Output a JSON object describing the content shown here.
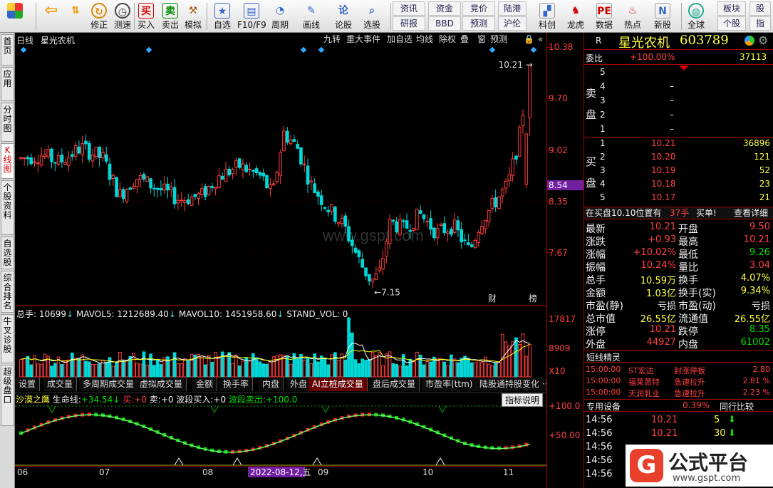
{
  "toolbar": {
    "buttons": [
      {
        "id": "home",
        "label": "",
        "icon": "grid-icon"
      },
      {
        "id": "back",
        "label": "",
        "icon": "back-arrow-icon"
      },
      {
        "id": "updown",
        "label": "",
        "icon": "up-down-icon"
      },
      {
        "id": "xiuzheng",
        "label": "修正",
        "icon": "repair-icon"
      },
      {
        "id": "cece",
        "label": "测速",
        "icon": "clock-icon"
      },
      {
        "id": "mairu",
        "label": "买入",
        "icon": "buy-icon"
      },
      {
        "id": "maichu",
        "label": "卖出",
        "icon": "sell-icon"
      },
      {
        "id": "moni",
        "label": "模拟",
        "icon": "hammer-icon"
      },
      {
        "id": "zixuan",
        "label": "自选",
        "icon": "star-icon"
      },
      {
        "id": "f10",
        "label": "F10/F9",
        "icon": "window-icon"
      },
      {
        "id": "zhouqi",
        "label": "周期",
        "icon": "period-icon"
      },
      {
        "id": "huaxian",
        "label": "画线",
        "icon": "pencil-icon"
      },
      {
        "id": "lungu",
        "label": "论股",
        "icon": "discuss-icon"
      },
      {
        "id": "xuangu",
        "label": "选股",
        "icon": "magnifier-icon"
      }
    ],
    "grid_buttons": [
      [
        "资讯",
        "资金",
        "竞价",
        "陆港"
      ],
      [
        "研报",
        "BBD",
        "预测",
        "沪伦"
      ]
    ],
    "right_buttons": [
      {
        "id": "kechuang",
        "label": "科创",
        "icon": "chart-icon"
      },
      {
        "id": "longhu",
        "label": "龙虎",
        "icon": "dragon-icon"
      },
      {
        "id": "shuju",
        "label": "数据",
        "icon": "pe-icon"
      },
      {
        "id": "redian",
        "label": "热点",
        "icon": "fire-icon"
      },
      {
        "id": "xingu",
        "label": "新股",
        "icon": "newstock-icon"
      },
      {
        "id": "quanqiu",
        "label": "全球",
        "icon": "globe-icon"
      },
      {
        "id": "bankuai",
        "label": "板块"
      },
      {
        "id": "gegu",
        "label": "个股"
      },
      {
        "id": "gu",
        "label": "股"
      },
      {
        "id": "zhi",
        "label": "指"
      }
    ]
  },
  "left_tabs": [
    "首页",
    "应用",
    "分时图",
    "K线图",
    "个股资料",
    "自选股",
    "综合排名",
    "牛叉诊股",
    "超级盘口"
  ],
  "chart": {
    "period": "日线",
    "name": "星光农机",
    "buttons": [
      "九转",
      "重大事件",
      "加自选",
      "均线",
      "除权",
      "叠",
      "窗",
      "预测",
      "🔒",
      "«"
    ],
    "high_label": "10.21",
    "low_label": "7.15",
    "price_marker": "8.54",
    "yticks": [
      "10.38",
      "9.70",
      "9.02",
      "8.35",
      "7.67"
    ],
    "tags": [
      "财",
      "榜"
    ],
    "watermark": "www.gspt.com"
  },
  "volume": {
    "header": {
      "label": "总手:",
      "value": "10699",
      "mavol5_label": "MAVOL5:",
      "mavol5": "1212689.40",
      "mavol10_label": "MAVOL10:",
      "mavol10": "1451958.60",
      "stand_label": "STAND_VOL:",
      "stand": "0"
    },
    "yticks": [
      "17817",
      "8909",
      "X10"
    ],
    "tabs": [
      "设置",
      "成交量",
      "多周期成交量",
      "虚拟成交量",
      "金额",
      "换手率",
      "内盘",
      "外盘",
      "AI立桩成交量",
      "盘后成交量",
      "市盈率(ttm)",
      "陆股通持股变化",
      "···"
    ]
  },
  "indicator": {
    "name": "沙漠之鹰",
    "life_label": "生命线:",
    "life_value": "+34.54",
    "buy_label": "买:",
    "buy_value": "+0",
    "sell_label": "卖:",
    "sell_value": "+0",
    "wave_buy_label": "波段买入:",
    "wave_buy_value": "+0",
    "wave_sell_label": "波段卖出:",
    "wave_sell_value": "+100.0",
    "help": "指标说明",
    "yticks": [
      "+100.0",
      "+50.00"
    ]
  },
  "xaxis": {
    "labels": [
      "06",
      "07",
      "08",
      "09",
      "10",
      "11"
    ],
    "highlight": "2022-08-12,五"
  },
  "quote": {
    "R": "R",
    "name": "星光农机",
    "code": "603789",
    "weibi_label": "委比",
    "weibi": "+100.00%",
    "weicha": "37113",
    "sell_label": "卖盘",
    "buy_label": "买盘",
    "sell": [
      {
        "n": "5",
        "p": "",
        "v": ""
      },
      {
        "n": "4",
        "p": "–",
        "v": ""
      },
      {
        "n": "3",
        "p": "–",
        "v": ""
      },
      {
        "n": "2",
        "p": "–",
        "v": ""
      },
      {
        "n": "1",
        "p": "–",
        "v": ""
      }
    ],
    "buy": [
      {
        "n": "1",
        "p": "10.21",
        "v": "36896"
      },
      {
        "n": "2",
        "p": "10.20",
        "v": "121"
      },
      {
        "n": "3",
        "p": "10.19",
        "v": "52"
      },
      {
        "n": "4",
        "p": "10.18",
        "v": "23"
      },
      {
        "n": "5",
        "p": "10.17",
        "v": "21"
      }
    ],
    "notice": "在买盘10.10位置有",
    "notice_vol": "37手",
    "notice_type": "买单!",
    "notice_btn": "查看详细",
    "stats": [
      {
        "l1": "最新",
        "v1": "10.21",
        "c1": "red",
        "l2": "开盘",
        "v2": "9.50",
        "c2": "red"
      },
      {
        "l1": "涨跌",
        "v1": "+0.93",
        "c1": "red",
        "l2": "最高",
        "v2": "10.21",
        "c2": "red"
      },
      {
        "l1": "涨幅",
        "v1": "+10.02%",
        "c1": "red",
        "l2": "最低",
        "v2": "9.26",
        "c2": "grn"
      },
      {
        "l1": "振幅",
        "v1": "10.24%",
        "c1": "red",
        "l2": "量比",
        "v2": "3.04",
        "c2": "red"
      },
      {
        "l1": "总手",
        "v1": "10.59万",
        "c1": "yel",
        "l2": "换手",
        "v2": "4.07%",
        "c2": "yel"
      },
      {
        "l1": "金额",
        "v1": "1.03亿",
        "c1": "yel",
        "l2": "换手(实)",
        "v2": "9.34%",
        "c2": "yel"
      },
      {
        "l1": "市盈(静)",
        "v1": "亏损",
        "c1": "wht",
        "l2": "市盈(动)",
        "v2": "亏损",
        "c2": "wht"
      },
      {
        "l1": "总市值",
        "v1": "26.55亿",
        "c1": "yel",
        "l2": "流通值",
        "v2": "26.55亿",
        "c2": "yel"
      },
      {
        "l1": "涨停",
        "v1": "10.21",
        "c1": "red",
        "l2": "跌停",
        "v2": "8.35",
        "c2": "grn"
      },
      {
        "l1": "外盘",
        "v1": "44927",
        "c1": "red",
        "l2": "内盘",
        "v2": "61002",
        "c2": "grn"
      }
    ],
    "jingling_title": "短线精灵",
    "jingling": [
      {
        "t": "15:00:00",
        "n": "ST宏达",
        "e": "封涨停板",
        "v": "2.80"
      },
      {
        "t": "15:00:00",
        "n": "福莱蒽特",
        "e": "急速拉升",
        "v": "2.81 %"
      },
      {
        "t": "15:00:00",
        "n": "天润乳业",
        "e": "急速拉升",
        "v": "2.23 %"
      }
    ],
    "device_label": "专用设备",
    "device_pct": "0.39%",
    "compare": "同行比较",
    "ticks": [
      {
        "t": "14:56",
        "p": "10.21",
        "v": "5",
        "d": "up"
      },
      {
        "t": "14:56",
        "p": "10.21",
        "v": "30",
        "d": "up"
      },
      {
        "t": "14:56",
        "p": "",
        "v": "",
        "d": ""
      },
      {
        "t": "14:56",
        "p": "",
        "v": "",
        "d": ""
      },
      {
        "t": "14:56",
        "p": "",
        "v": "",
        "d": ""
      }
    ],
    "logo_text": "公式平台",
    "logo_url": "www.gspt.com"
  }
}
